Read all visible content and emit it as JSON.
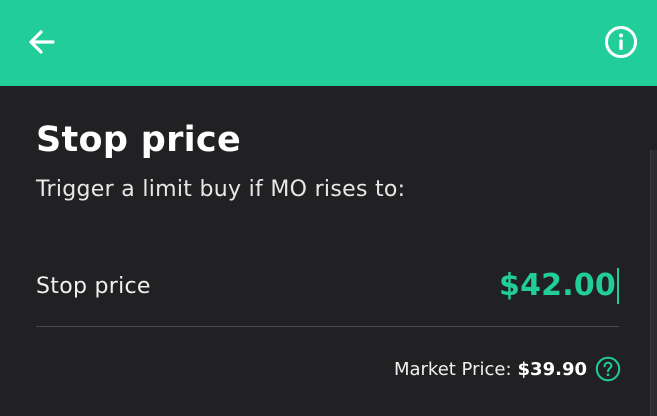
{
  "colors": {
    "accent": "#21ce99",
    "background": "#212123",
    "text": "#ffffff"
  },
  "header": {
    "back_icon": "arrow-left-icon",
    "info_icon": "info-icon"
  },
  "main": {
    "title": "Stop price",
    "subtitle": "Trigger a limit buy if MO rises to:",
    "field_label": "Stop price",
    "field_value": "$42.00",
    "market_label": "Market Price:",
    "market_value": "$39.90",
    "help_icon": "question-circle-icon"
  }
}
